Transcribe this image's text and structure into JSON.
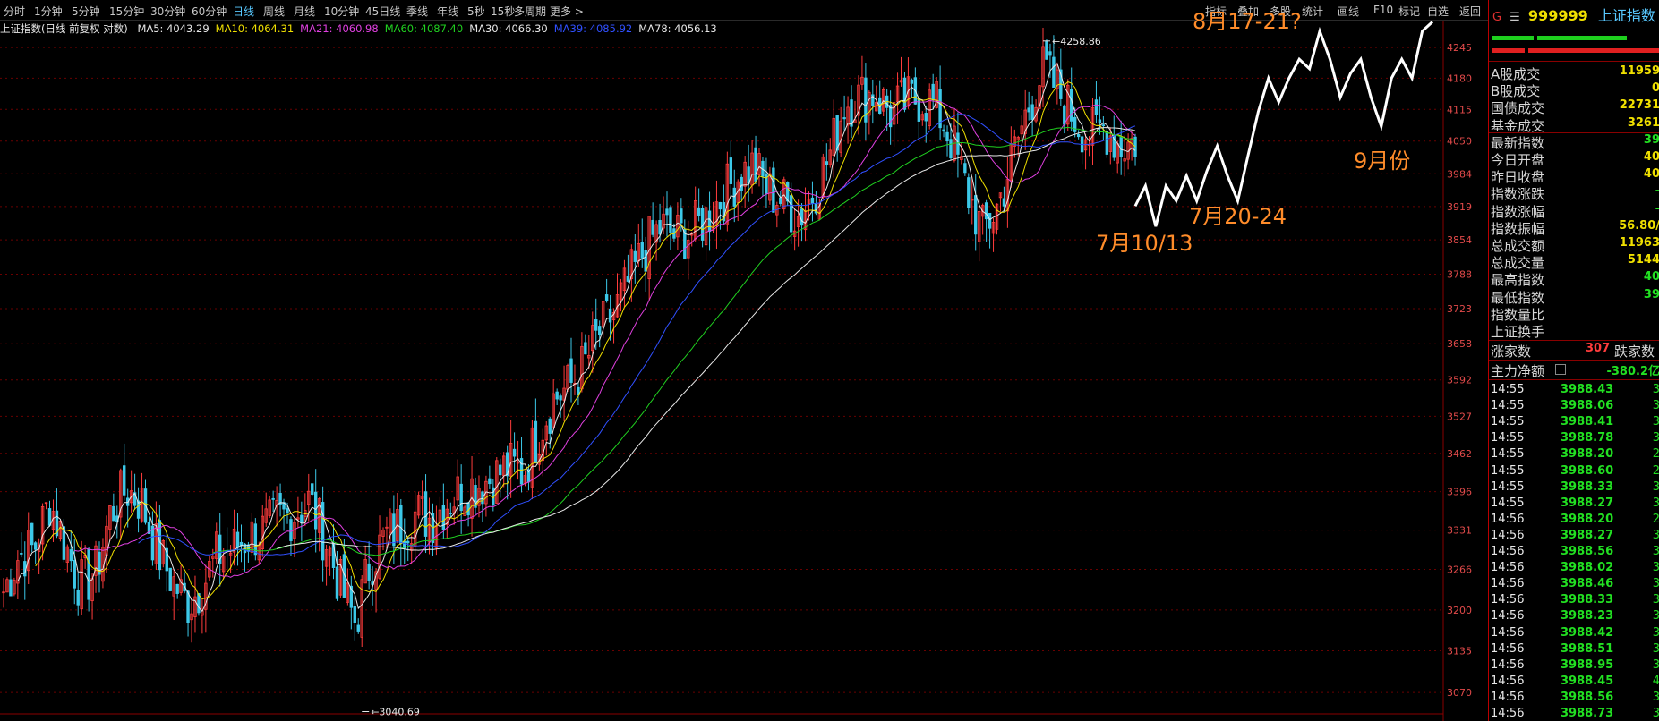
{
  "toolbar": {
    "periods": [
      "分时",
      "1分钟",
      "5分钟",
      "15分钟",
      "30分钟",
      "60分钟",
      "日线",
      "周线",
      "月线",
      "10分钟",
      "45日线",
      "季线",
      "年线",
      "5秒",
      "15秒",
      "多周期",
      "更多 >"
    ],
    "active_period": "日线",
    "right_tools": [
      "指标",
      "叠加",
      "多股",
      "统计",
      "画线",
      "F10",
      "标记",
      "自选",
      "返回"
    ]
  },
  "legend": {
    "title": "上证指数(日线 前复权 对数)",
    "items": [
      {
        "label": "MA5: 4043.29",
        "color": "#e8e8e8"
      },
      {
        "label": "MA10: 4064.31",
        "color": "#f0e000"
      },
      {
        "label": "MA21: 4060.98",
        "color": "#e040e0"
      },
      {
        "label": "MA60: 4087.40",
        "color": "#20d020"
      },
      {
        "label": "MA30: 4066.30",
        "color": "#e8e8e8"
      },
      {
        "label": "MA39: 4085.92",
        "color": "#3050ff"
      },
      {
        "label": "MA78: 4056.13",
        "color": "#e8e8e8"
      }
    ]
  },
  "chart_data": {
    "type": "candlestick",
    "title": "上证指数(日线 前复权 对数)",
    "y_axis_ticks": [
      4245,
      4180,
      4115,
      4050,
      3984,
      3919,
      3854,
      3788,
      3723,
      3658,
      3592,
      3527,
      3462,
      3396,
      3331,
      3266,
      3200,
      3135,
      3070
    ],
    "ylim": [
      3040,
      4270
    ],
    "y_scale": "log",
    "extremes": {
      "high": 4258.86,
      "low": 3040.69
    },
    "close_trend": [
      3230,
      3290,
      3300,
      3380,
      3310,
      3240,
      3260,
      3360,
      3400,
      3380,
      3300,
      3250,
      3210,
      3240,
      3290,
      3300,
      3320,
      3330,
      3350,
      3360,
      3380,
      3320,
      3240,
      3180,
      3280,
      3320,
      3340,
      3360,
      3350,
      3380,
      3400,
      3410,
      3420,
      3440,
      3430,
      3500,
      3560,
      3580,
      3620,
      3680,
      3720,
      3780,
      3840,
      3880,
      3860,
      3870,
      3900,
      3940,
      3980,
      4000,
      3950,
      3930,
      3900,
      3950,
      4020,
      4130,
      4140,
      4150,
      4110,
      4130,
      4140,
      4120,
      4050,
      3950,
      3870,
      3920,
      4020,
      4120,
      4200,
      4150,
      4100,
      4060,
      4080,
      4040,
      4050
    ],
    "ma_series": [
      {
        "name": "MA5",
        "color": "#e8e8e8"
      },
      {
        "name": "MA10",
        "color": "#f0e000"
      },
      {
        "name": "MA21",
        "color": "#e040e0"
      },
      {
        "name": "MA60",
        "color": "#20d020"
      },
      {
        "name": "MA39",
        "color": "#3050ff"
      },
      {
        "name": "MA78",
        "color": "#e8e8e8"
      }
    ],
    "annotations": [
      "8月17-21?",
      "9月份",
      "7月20-24",
      "7月10/13"
    ],
    "projection_path": [
      3920,
      3960,
      3880,
      3960,
      3930,
      3980,
      3930,
      3990,
      4040,
      3980,
      3930,
      4020,
      4110,
      4180,
      4130,
      4180,
      4220,
      4200,
      4280,
      4220,
      4140,
      4190,
      4220,
      4140,
      4080,
      4180,
      4220,
      4180,
      4280,
      4300
    ]
  },
  "quote": {
    "code": "999999",
    "name": "上证指数",
    "rows": [
      {
        "label": "A股成交",
        "value": "11959"
      },
      {
        "label": "B股成交",
        "value": "0"
      },
      {
        "label": "国债成交",
        "value": "22731"
      },
      {
        "label": "基金成交",
        "value": "3261"
      },
      {
        "label": "最新指数",
        "value": "39"
      },
      {
        "label": "今日开盘",
        "value": "40"
      },
      {
        "label": "昨日收盘",
        "value": "40"
      },
      {
        "label": "指数涨跌",
        "value": "-"
      },
      {
        "label": "指数涨幅",
        "value": "-"
      },
      {
        "label": "指数振幅",
        "value": "56.80/"
      },
      {
        "label": "总成交额",
        "value": "11963"
      },
      {
        "label": "总成交量",
        "value": "5144"
      },
      {
        "label": "最高指数",
        "value": "40"
      },
      {
        "label": "最低指数",
        "value": "39"
      },
      {
        "label": "指数量比",
        "value": ""
      },
      {
        "label": "上证换手",
        "value": ""
      }
    ],
    "up_label": "涨家数",
    "up_count": "307",
    "down_label": "跌家数",
    "main_flow_label": "主力净额",
    "main_flow_value": "-380.2亿",
    "ticks": [
      {
        "time": "14:55",
        "price": "3988.43",
        "vol": "3"
      },
      {
        "time": "14:55",
        "price": "3988.06",
        "vol": "3"
      },
      {
        "time": "14:55",
        "price": "3988.41",
        "vol": "3"
      },
      {
        "time": "14:55",
        "price": "3988.78",
        "vol": "3"
      },
      {
        "time": "14:55",
        "price": "3988.20",
        "vol": "2"
      },
      {
        "time": "14:55",
        "price": "3988.60",
        "vol": "2"
      },
      {
        "time": "14:55",
        "price": "3988.33",
        "vol": "3"
      },
      {
        "time": "14:55",
        "price": "3988.27",
        "vol": "3"
      },
      {
        "time": "14:56",
        "price": "3988.20",
        "vol": "2"
      },
      {
        "time": "14:56",
        "price": "3988.27",
        "vol": "3"
      },
      {
        "time": "14:56",
        "price": "3988.56",
        "vol": "3"
      },
      {
        "time": "14:56",
        "price": "3988.02",
        "vol": "3"
      },
      {
        "time": "14:56",
        "price": "3988.46",
        "vol": "3"
      },
      {
        "time": "14:56",
        "price": "3988.33",
        "vol": "3"
      },
      {
        "time": "14:56",
        "price": "3988.23",
        "vol": "3"
      },
      {
        "time": "14:56",
        "price": "3988.42",
        "vol": "3"
      },
      {
        "time": "14:56",
        "price": "3988.51",
        "vol": "3"
      },
      {
        "time": "14:56",
        "price": "3988.95",
        "vol": "3"
      },
      {
        "time": "14:56",
        "price": "3988.45",
        "vol": "4"
      },
      {
        "time": "14:56",
        "price": "3988.56",
        "vol": "3"
      },
      {
        "time": "14:56",
        "price": "3988.73",
        "vol": "3"
      }
    ]
  }
}
